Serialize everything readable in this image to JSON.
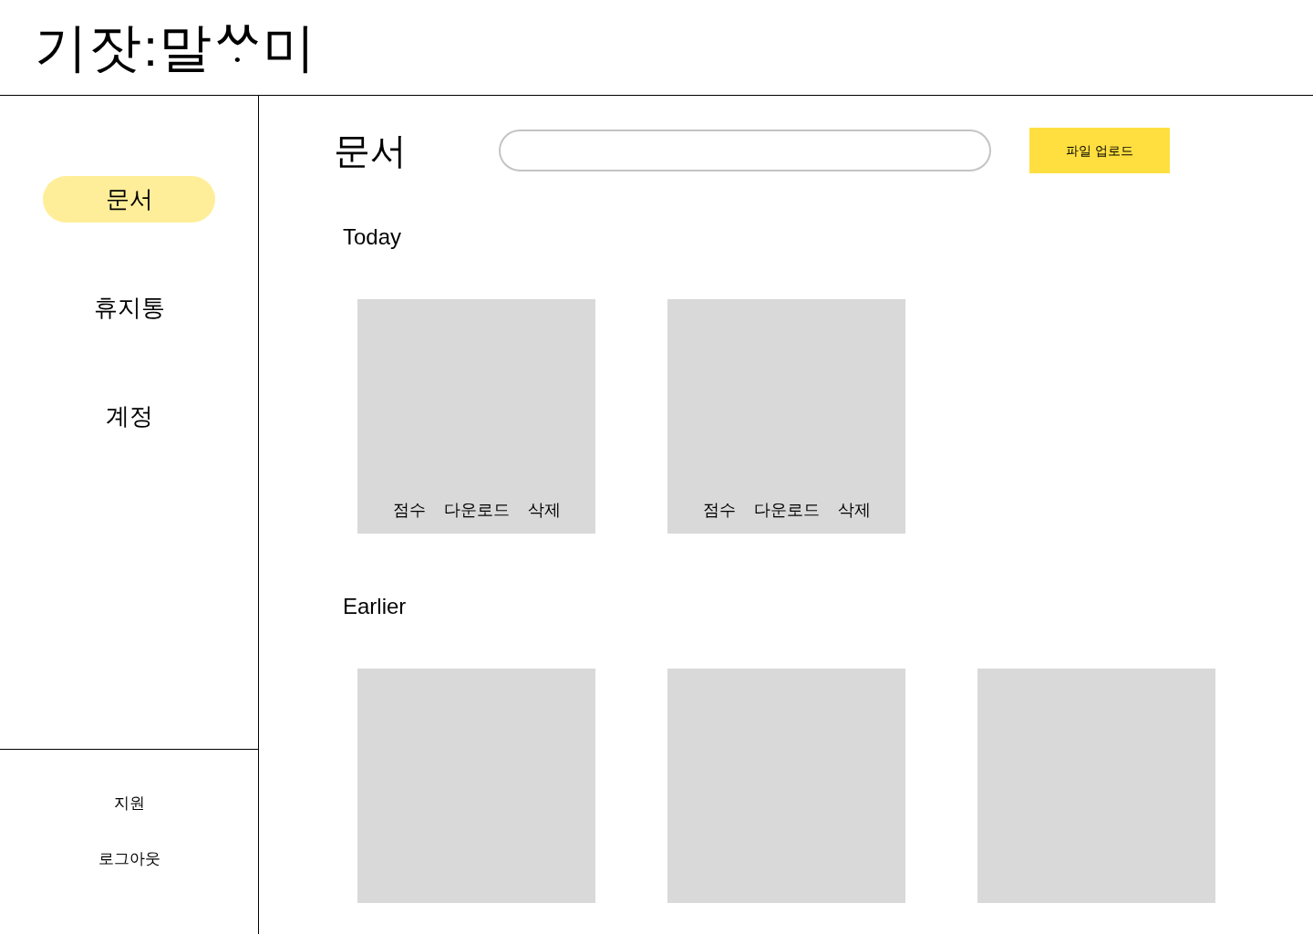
{
  "logo": "기잣:말ᄊᆞ미",
  "sidebar": {
    "items": [
      {
        "label": "문서",
        "selected": true
      },
      {
        "label": "휴지통",
        "selected": false
      },
      {
        "label": "계정",
        "selected": false
      }
    ],
    "footer_links": [
      "지원",
      "로그아웃"
    ]
  },
  "main": {
    "title": "문서",
    "upload_button": "파일 업로드",
    "sections": [
      {
        "title": "Today",
        "cards": [
          {
            "kind": "with_actions",
            "actions": [
              "점수",
              "다운로드",
              "삭제"
            ]
          },
          {
            "kind": "with_actions",
            "actions": [
              "점수",
              "다운로드",
              "삭제"
            ]
          }
        ]
      },
      {
        "title": "Earlier",
        "cards": [
          {
            "kind": "plain"
          },
          {
            "kind": "plain"
          },
          {
            "kind": "plain"
          }
        ]
      }
    ]
  }
}
